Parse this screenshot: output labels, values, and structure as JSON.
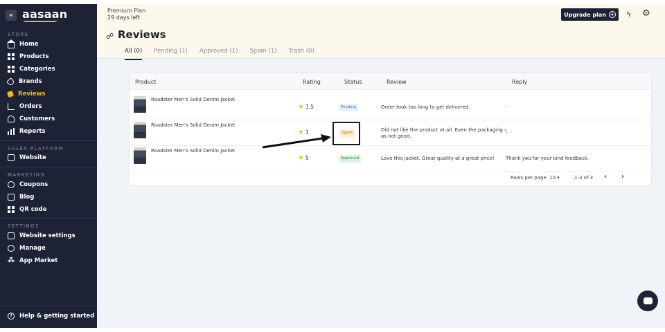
{
  "sidebar": {
    "logo": "aasaan",
    "sections": [
      {
        "label": "STORE",
        "items": [
          {
            "label": "Home",
            "icon": "home-icon"
          },
          {
            "label": "Products",
            "icon": "products-icon"
          },
          {
            "label": "Categories",
            "icon": "categories-icon"
          },
          {
            "label": "Brands",
            "icon": "tag-icon"
          },
          {
            "label": "Reviews",
            "icon": "reviews-icon",
            "active": true
          },
          {
            "label": "Orders",
            "icon": "cart-icon"
          },
          {
            "label": "Customers",
            "icon": "user-icon"
          },
          {
            "label": "Reports",
            "icon": "bar-chart-icon"
          }
        ]
      },
      {
        "label": "SALES PLATFORM",
        "items": [
          {
            "label": "Website",
            "icon": "monitor-icon"
          }
        ]
      },
      {
        "label": "MARKETING",
        "items": [
          {
            "label": "Coupons",
            "icon": "coupon-icon"
          },
          {
            "label": "Blog",
            "icon": "blog-icon"
          },
          {
            "label": "QR code",
            "icon": "qr-code-icon"
          }
        ]
      },
      {
        "label": "SETTINGS",
        "items": [
          {
            "label": "Website settings",
            "icon": "website-settings-icon"
          },
          {
            "label": "Manage",
            "icon": "gear-icon"
          },
          {
            "label": "App Market",
            "icon": "app-market-icon"
          }
        ]
      }
    ],
    "help": "Help & getting started"
  },
  "banner": {
    "plan_name": "Premium Plan",
    "plan_days": "29 days left",
    "upgrade_label": "Upgrade plan"
  },
  "page": {
    "title": "Reviews",
    "tabs": [
      "All (0)",
      "Pending (1)",
      "Approved (1)",
      "Spam (1)",
      "Trash (0)"
    ]
  },
  "table": {
    "headers": [
      "Product",
      "Rating",
      "Status",
      "Review",
      "Reply"
    ],
    "rows": [
      {
        "product": "Roadster Men's Solid Denim Jacket",
        "rating": "1.5",
        "status": "Pending",
        "review": [
          "Order took too long to get delivered."
        ],
        "reply": "-"
      },
      {
        "product": "Roadster Men's Solid Denim Jacket",
        "rating": "1",
        "status": "Spam",
        "review": [
          "Did not like the product at all. Even the packaging w",
          "as not good."
        ],
        "reply": "-"
      },
      {
        "product": "Roadster Men's Solid Denim Jacket",
        "rating": "5",
        "status": "Approved",
        "review": [
          "Love this jacket. Great quality at a great price!"
        ],
        "reply": "Thank you for your kind feedback."
      }
    ],
    "footer": {
      "rows_per_page_label": "Rows per page",
      "rows_per_page_value": "10",
      "range": "1-3 of 3"
    }
  },
  "colors": {
    "sidebar_bg": "#1e2235",
    "accent": "#f2b81a",
    "banner_bg": "#fdf8ec"
  }
}
